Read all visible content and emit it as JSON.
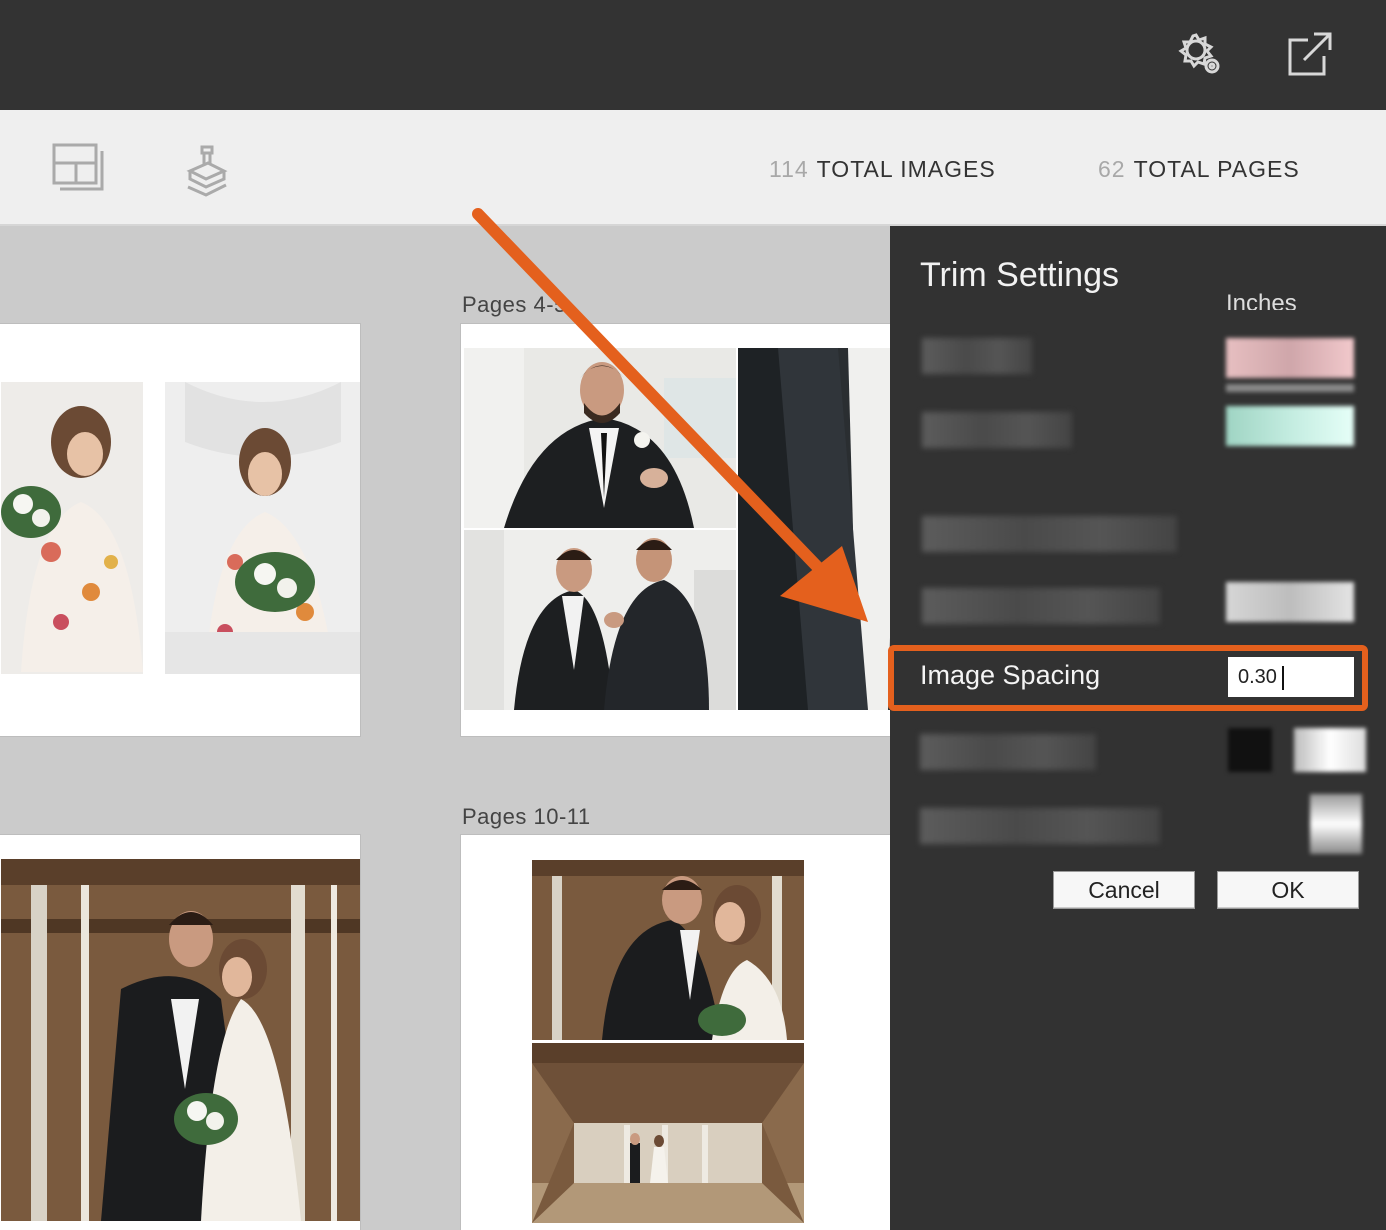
{
  "topbar": {
    "icons": [
      "settings-gear-icon",
      "open-external-icon"
    ]
  },
  "toolbar": {
    "icons": [
      "layout-template-icon",
      "stamp-icon"
    ],
    "total_images": {
      "value": "114",
      "label": "TOTAL IMAGES"
    },
    "total_pages": {
      "value": "62",
      "label": "TOTAL PAGES"
    }
  },
  "spreads": [
    {
      "label": ""
    },
    {
      "label": "Pages 4-5"
    },
    {
      "label": ""
    },
    {
      "label": "Pages 10-11"
    }
  ],
  "trim_panel": {
    "title": "Trim Settings",
    "units_label": "Inches",
    "image_spacing": {
      "label": "Image Spacing",
      "value": "0.30"
    },
    "cancel_label": "Cancel",
    "ok_label": "OK"
  },
  "colors": {
    "accent": "#e4601d",
    "panel_bg": "#323232",
    "topbar_bg": "#333333"
  }
}
